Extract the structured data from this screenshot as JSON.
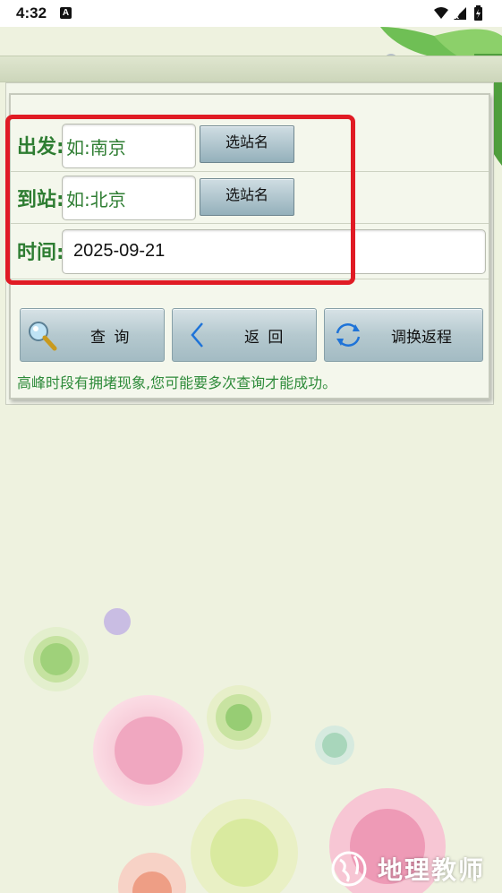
{
  "status_bar": {
    "time": "4:32",
    "notification_glyph": "A"
  },
  "form": {
    "departure": {
      "label": "出发:",
      "placeholder": "如:南京",
      "pick_button": "选站名"
    },
    "arrival": {
      "label": "到站:",
      "placeholder": "如:北京",
      "pick_button": "选站名"
    },
    "date": {
      "label": "时间:",
      "value": "2025-09-21"
    }
  },
  "actions": {
    "query": "查 询",
    "back": "返 回",
    "swap": "调换返程"
  },
  "tip": "高峰时段有拥堵现象,您可能要多次查询才能成功。",
  "watermark": "地理教师",
  "colors": {
    "label_green": "#2e7d32",
    "highlight_red": "#e01b24",
    "background": "#eef2df"
  },
  "icons": [
    "magnifier-icon",
    "chevron-left-icon",
    "refresh-icon",
    "wifi-icon",
    "signal-icon",
    "battery-icon"
  ]
}
